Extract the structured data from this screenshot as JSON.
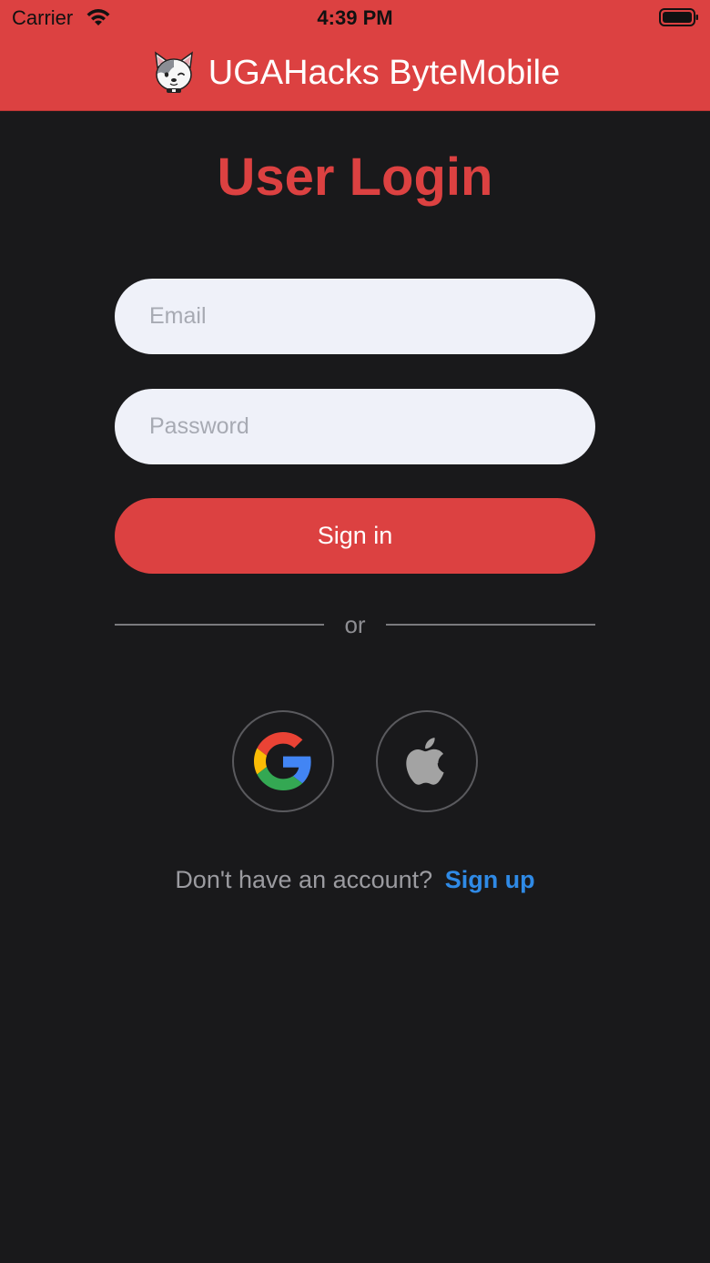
{
  "status_bar": {
    "carrier": "Carrier",
    "time": "4:39 PM"
  },
  "header": {
    "title": "UGAHacks ByteMobile",
    "logo": "dog-mascot-icon"
  },
  "login": {
    "title": "User Login",
    "email_placeholder": "Email",
    "password_placeholder": "Password",
    "signin_label": "Sign in",
    "divider_text": "or",
    "social": [
      "google-icon",
      "apple-icon"
    ],
    "signup_prompt": "Don't have an account?",
    "signup_link": "Sign up"
  },
  "colors": {
    "accent": "#dc4141",
    "background": "#19191b",
    "input_bg": "#eff1f9",
    "link": "#2f8ae6"
  }
}
